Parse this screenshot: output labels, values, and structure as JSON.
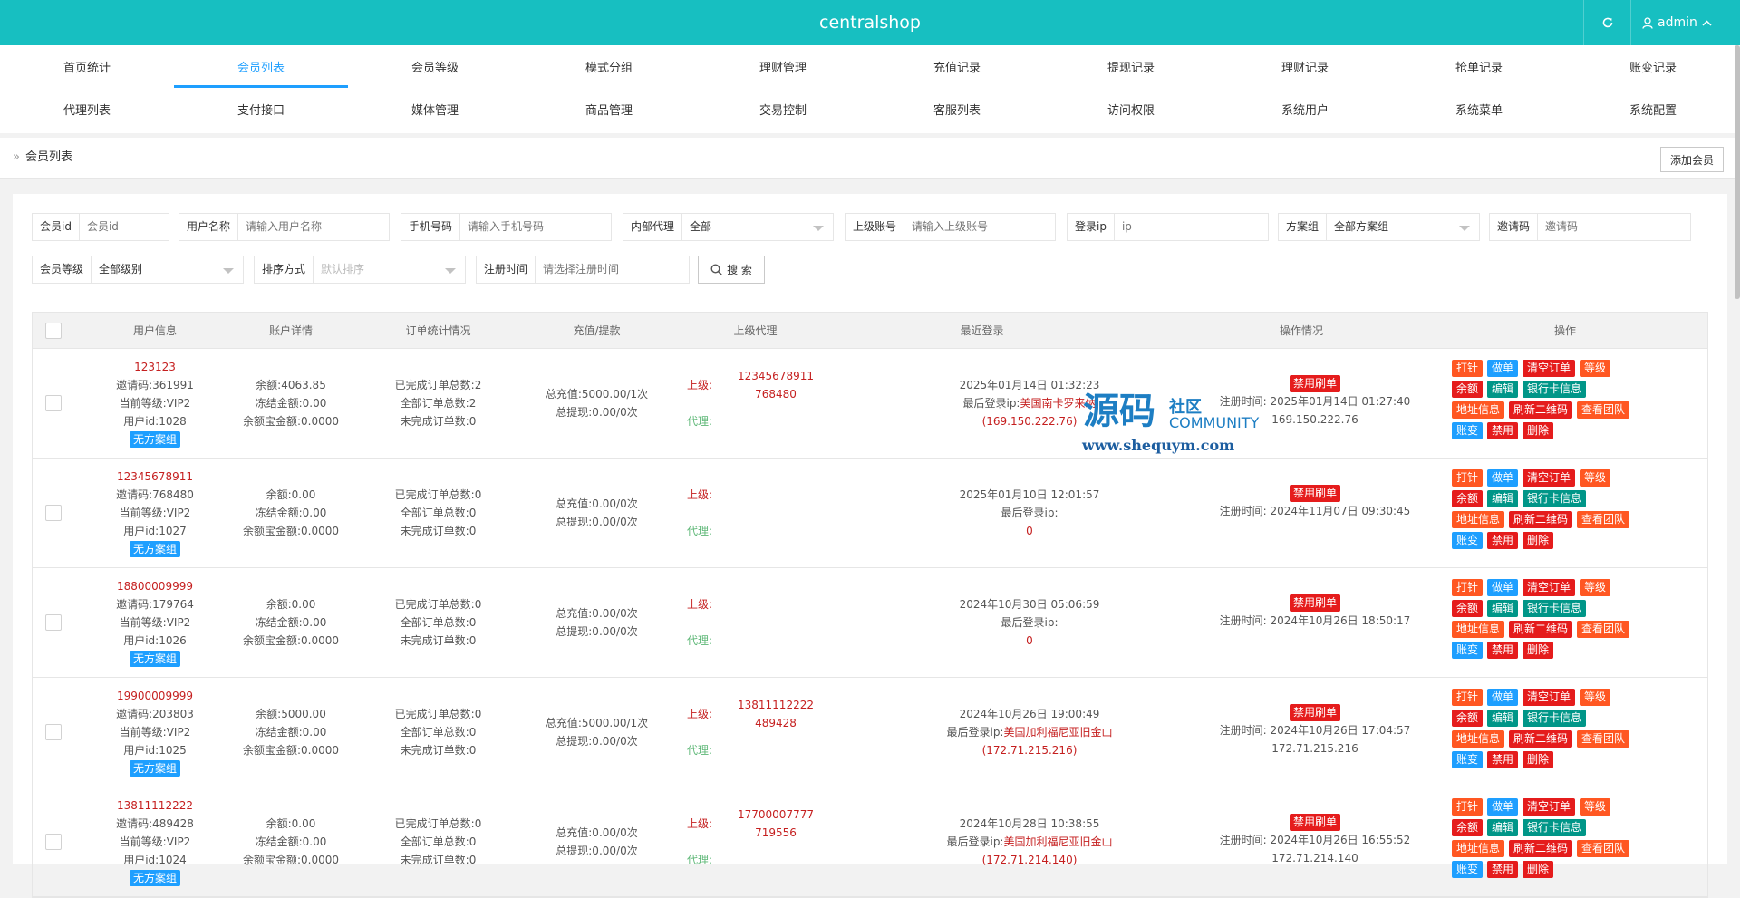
{
  "header": {
    "title": "centralshop",
    "user": "admin"
  },
  "nav": {
    "row1": [
      "首页统计",
      "会员列表",
      "会员等级",
      "模式分组",
      "理财管理",
      "充值记录",
      "提现记录",
      "理财记录",
      "抢单记录",
      "账变记录"
    ],
    "row2": [
      "代理列表",
      "支付接口",
      "媒体管理",
      "商品管理",
      "交易控制",
      "客服列表",
      "访问权限",
      "系统用户",
      "系统菜单",
      "系统配置"
    ],
    "active": "会员列表"
  },
  "breadcrumb": "会员列表",
  "add_button": "添加会员",
  "filters": {
    "member_id": {
      "label": "会员id",
      "placeholder": "会员id"
    },
    "username": {
      "label": "用户名称",
      "placeholder": "请输入用户名称"
    },
    "phone": {
      "label": "手机号码",
      "placeholder": "请输入手机号码"
    },
    "internal_agent": {
      "label": "内部代理",
      "value": "全部"
    },
    "parent_account": {
      "label": "上级账号",
      "placeholder": "请输入上级账号"
    },
    "login_ip": {
      "label": "登录ip",
      "placeholder": "ip"
    },
    "plan_group": {
      "label": "方案组",
      "value": "全部方案组"
    },
    "invite_code": {
      "label": "邀请码",
      "placeholder": "邀请码"
    },
    "member_level": {
      "label": "会员等级",
      "value": "全部级别"
    },
    "sort": {
      "label": "排序方式",
      "value": "默认排序"
    },
    "register_time": {
      "label": "注册时间",
      "placeholder": "请选择注册时间"
    },
    "search_button": "搜 索"
  },
  "table": {
    "headers": [
      "用户信息",
      "账户详情",
      "订单统计情况",
      "充值/提款",
      "上级代理",
      "最近登录",
      "操作情况",
      "操作"
    ],
    "action_labels": {
      "row1": [
        "打针",
        "做单",
        "清空订单",
        "等级"
      ],
      "row2": [
        "余额",
        "编辑",
        "银行卡信息"
      ],
      "row3": [
        "地址信息",
        "刷新二维码",
        "查看团队"
      ],
      "row4": [
        "账变",
        "禁用",
        "删除"
      ]
    },
    "rows": [
      {
        "phone": "123123",
        "invite": "邀请码:361991",
        "level": "当前等级:VIP2",
        "uid": "用户id:1028",
        "group": "无方案组",
        "balance": "余额:4063.85",
        "frozen": "冻结金额:0.00",
        "bao": "余额宝金额:0.0000",
        "done": "已完成订单总数:2",
        "all": "全部订单总数:2",
        "undone": "未完成订单数:0",
        "recharge": "总充值:5000.00/1次",
        "withdraw": "总提现:0.00/0次",
        "parent_label": "上级:",
        "parent": "12345678911",
        "parent_code": "768480",
        "agent_label": "代理:",
        "login_time": "2025年01月14日 01:32:23",
        "login_ip_label": "最后登录ip:",
        "login_ip_loc": "美国南卡罗来纳",
        "login_ip": "(169.150.222.76)",
        "status": "禁用刷单",
        "reg": "注册时间: 2025年01月14日 01:27:40",
        "reg_ip": "169.150.222.76"
      },
      {
        "phone": "12345678911",
        "invite": "邀请码:768480",
        "level": "当前等级:VIP2",
        "uid": "用户id:1027",
        "group": "无方案组",
        "balance": "余额:0.00",
        "frozen": "冻结金额:0.00",
        "bao": "余额宝金额:0.0000",
        "done": "已完成订单总数:0",
        "all": "全部订单总数:0",
        "undone": "未完成订单数:0",
        "recharge": "总充值:0.00/0次",
        "withdraw": "总提现:0.00/0次",
        "parent_label": "上级:",
        "parent": "",
        "parent_code": "",
        "agent_label": "代理:",
        "login_time": "2025年01月10日 12:01:57",
        "login_ip_label": "最后登录ip:",
        "login_ip_loc": "",
        "login_ip": "0",
        "status": "禁用刷单",
        "reg": "注册时间: 2024年11月07日 09:30:45",
        "reg_ip": ""
      },
      {
        "phone": "18800009999",
        "invite": "邀请码:179764",
        "level": "当前等级:VIP2",
        "uid": "用户id:1026",
        "group": "无方案组",
        "balance": "余额:0.00",
        "frozen": "冻结金额:0.00",
        "bao": "余额宝金额:0.0000",
        "done": "已完成订单总数:0",
        "all": "全部订单总数:0",
        "undone": "未完成订单数:0",
        "recharge": "总充值:0.00/0次",
        "withdraw": "总提现:0.00/0次",
        "parent_label": "上级:",
        "parent": "",
        "parent_code": "",
        "agent_label": "代理:",
        "login_time": "2024年10月30日 05:06:59",
        "login_ip_label": "最后登录ip:",
        "login_ip_loc": "",
        "login_ip": "0",
        "status": "禁用刷单",
        "reg": "注册时间: 2024年10月26日 18:50:17",
        "reg_ip": ""
      },
      {
        "phone": "19900009999",
        "invite": "邀请码:203803",
        "level": "当前等级:VIP2",
        "uid": "用户id:1025",
        "group": "无方案组",
        "balance": "余额:5000.00",
        "frozen": "冻结金额:0.00",
        "bao": "余额宝金额:0.0000",
        "done": "已完成订单总数:0",
        "all": "全部订单总数:0",
        "undone": "未完成订单数:0",
        "recharge": "总充值:5000.00/1次",
        "withdraw": "总提现:0.00/0次",
        "parent_label": "上级:",
        "parent": "13811112222",
        "parent_code": "489428",
        "agent_label": "代理:",
        "login_time": "2024年10月26日 19:00:49",
        "login_ip_label": "最后登录ip:",
        "login_ip_loc": "美国加利福尼亚旧金山",
        "login_ip": "(172.71.215.216)",
        "status": "禁用刷单",
        "reg": "注册时间: 2024年10月26日 17:04:57",
        "reg_ip": "172.71.215.216"
      },
      {
        "phone": "13811112222",
        "invite": "邀请码:489428",
        "level": "当前等级:VIP2",
        "uid": "用户id:1024",
        "group": "无方案组",
        "balance": "余额:0.00",
        "frozen": "冻结金额:0.00",
        "bao": "余额宝金额:0.0000",
        "done": "已完成订单总数:0",
        "all": "全部订单总数:0",
        "undone": "未完成订单数:0",
        "recharge": "总充值:0.00/0次",
        "withdraw": "总提现:0.00/0次",
        "parent_label": "上级:",
        "parent": "17700007777",
        "parent_code": "719556",
        "agent_label": "代理:",
        "login_time": "2024年10月28日 10:38:55",
        "login_ip_label": "最后登录ip:",
        "login_ip_loc": "美国加利福尼亚旧金山",
        "login_ip": "(172.71.214.140)",
        "status": "禁用刷单",
        "reg": "注册时间: 2024年10月26日 16:55:52",
        "reg_ip": "172.71.214.140"
      }
    ]
  },
  "watermark": {
    "main": "源码",
    "sub1": "社区",
    "sub2": "COMMUNITY",
    "url": "www.shequym.com"
  },
  "colors": {
    "header": "#17bfc1",
    "active_tab": "#1e9fff",
    "red_text": "#c51f1f"
  }
}
